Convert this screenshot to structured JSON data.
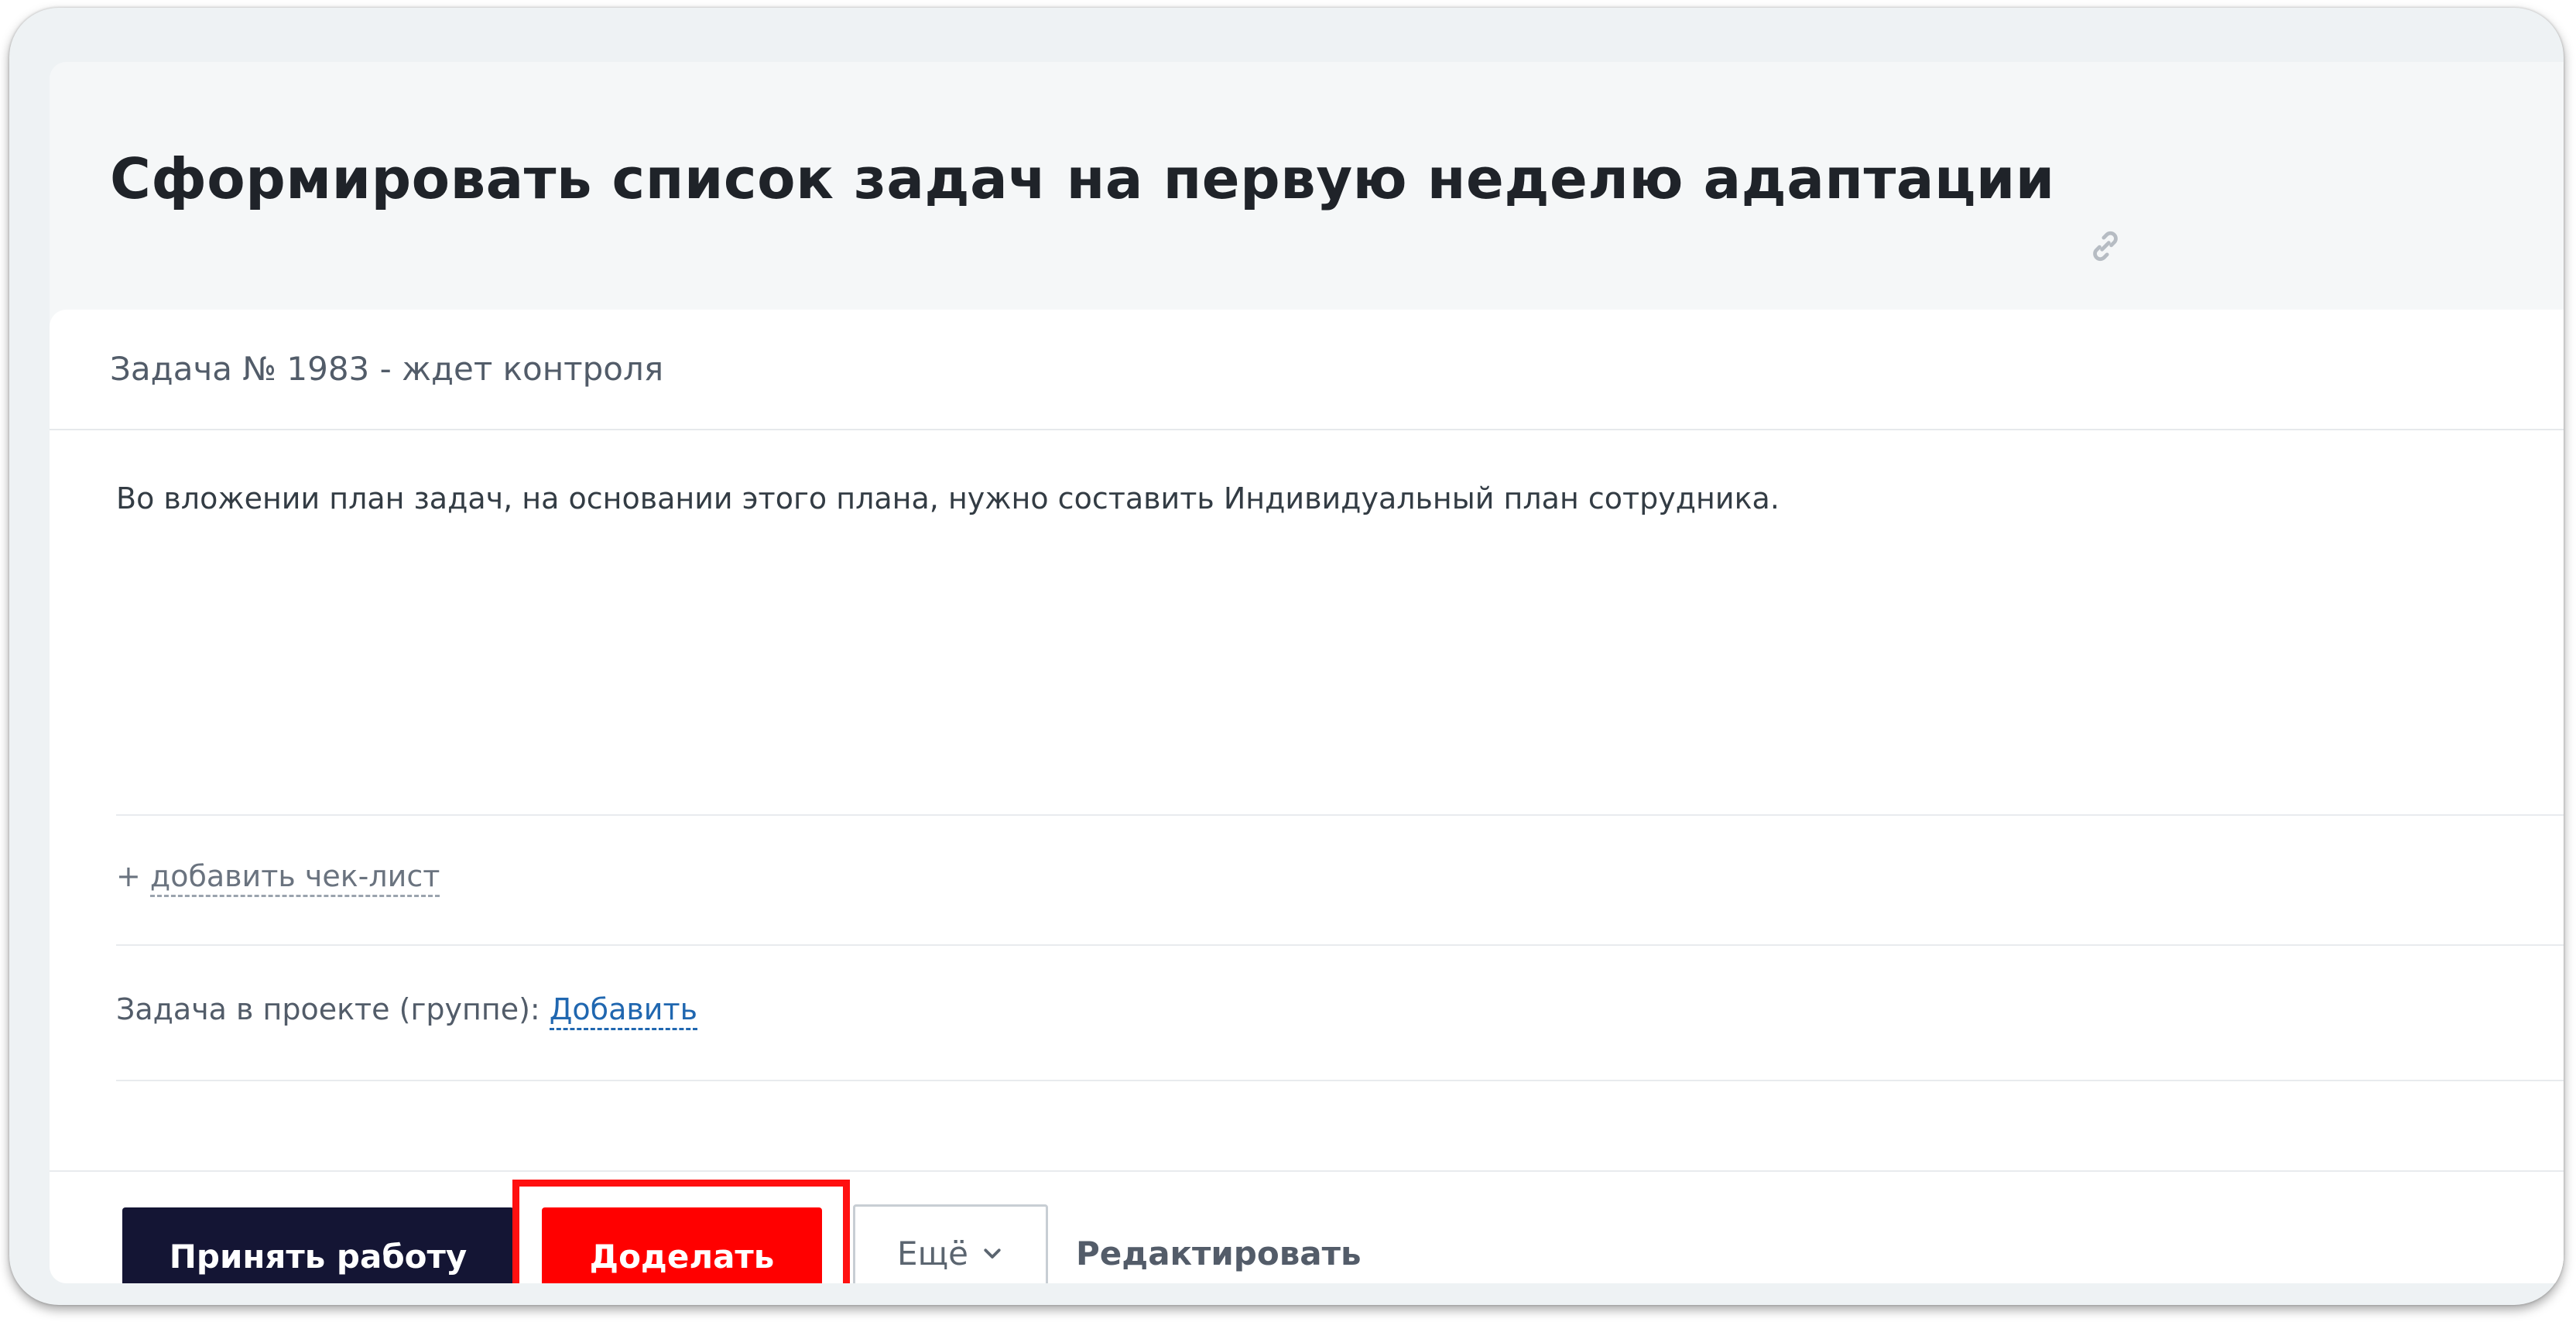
{
  "task": {
    "title": "Сформировать список задач на первую неделю адаптации",
    "header": "Задача № 1983 - ждет контроля",
    "description": "Во вложении план задач, на основании этого плана, нужно составить Индивидуальный план сотрудника.",
    "checklist": {
      "prefix": "+ ",
      "link": "добавить чек-лист"
    },
    "project": {
      "label": "Задача в проекте (группе):",
      "add_link": "Добавить"
    }
  },
  "actions": {
    "accept_label": "Принять работу",
    "redo_label": "Доделать",
    "more_label": "Ещё",
    "edit_label": "Редактировать"
  },
  "colors": {
    "accept_bg": "#141534",
    "redo_bg": "#ff0000",
    "highlight": "#ff1010",
    "link": "#2067b0"
  },
  "icons": {
    "title_link": "link-icon",
    "more_chevron": "chevron-down-icon"
  }
}
